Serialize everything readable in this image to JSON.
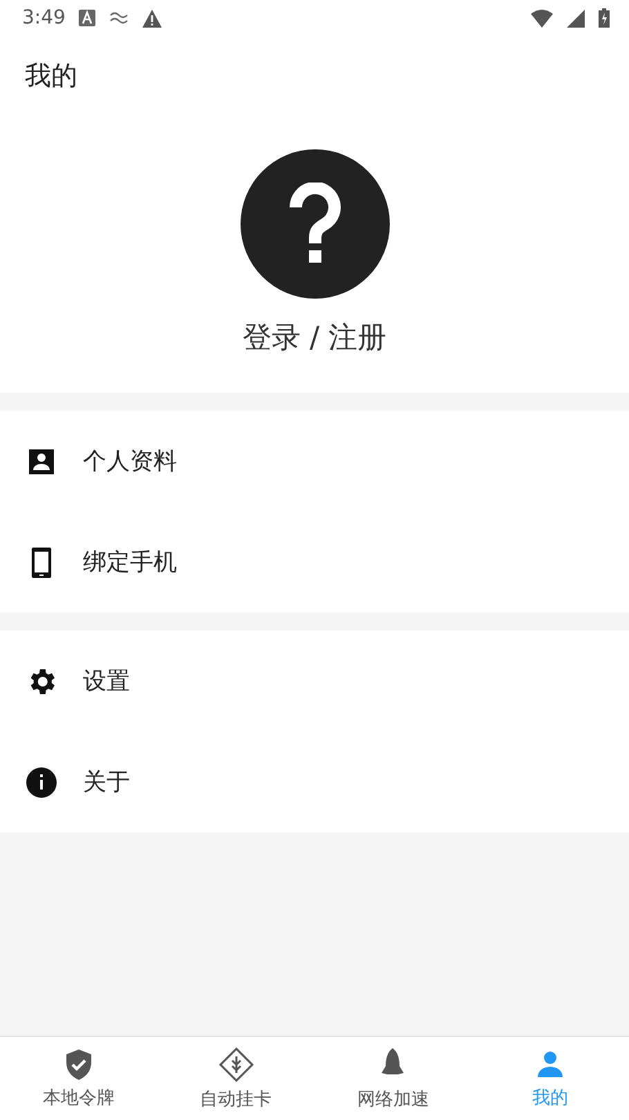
{
  "status_bar": {
    "time": "3:49"
  },
  "header": {
    "title": "我的"
  },
  "profile": {
    "login_label": "登录 / 注册"
  },
  "menu_groups": [
    {
      "items": [
        {
          "kind": "profile",
          "label": "个人资料"
        },
        {
          "kind": "phone",
          "label": "绑定手机"
        }
      ]
    },
    {
      "items": [
        {
          "kind": "settings",
          "label": "设置"
        },
        {
          "kind": "info",
          "label": "关于"
        }
      ]
    }
  ],
  "bottom_nav": [
    {
      "kind": "shield",
      "label": "本地令牌",
      "selected": false
    },
    {
      "kind": "auto",
      "label": "自动挂卡",
      "selected": false
    },
    {
      "kind": "rocket",
      "label": "网络加速",
      "selected": false
    },
    {
      "kind": "person",
      "label": "我的",
      "selected": true
    }
  ]
}
